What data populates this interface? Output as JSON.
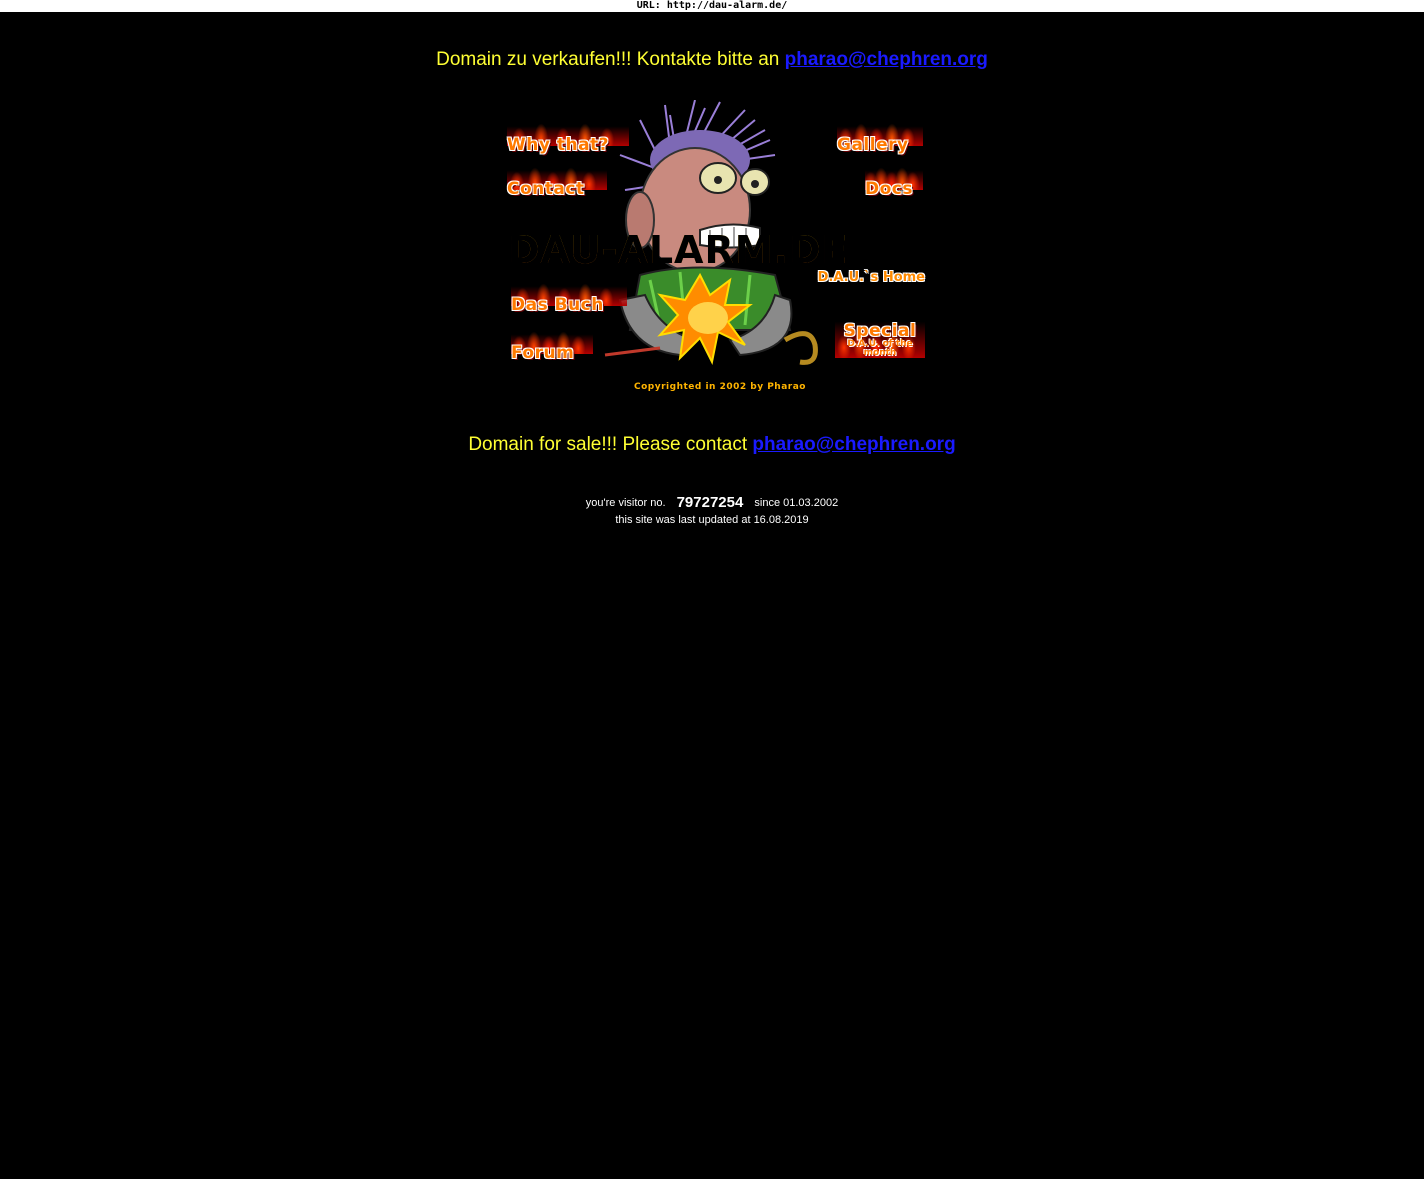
{
  "urlbar": {
    "text": "URL: http://dau-alarm.de/"
  },
  "sale_de": {
    "text": "Domain zu verkaufen!!! Kontakte bitte an ",
    "email": "pharao@chephren.org"
  },
  "sale_en": {
    "text": "Domain for sale!!! Please contact ",
    "email": "pharao@chephren.org"
  },
  "nav": {
    "why": "Why that?",
    "contact": "Contact",
    "gallery": "Gallery",
    "docs": "Docs",
    "buch": "Das Buch",
    "forum": "Forum",
    "special": "Special",
    "special_sub_1": "D.A.U. of the",
    "special_sub_2": "month"
  },
  "logo": {
    "title": "DAU-ALARM.DE",
    "tagline": "D.A.U.`s Home",
    "copyright": "Copyrighted in 2002 by Pharao"
  },
  "counter": {
    "prefix": "you're visitor no.",
    "number": "79727254",
    "suffix": "since 01.03.2002"
  },
  "updated": {
    "text": "this site was last updated at 16.08.2019"
  },
  "colors": {
    "background": "#000000",
    "sale_text": "#ffff33",
    "link": "#1a1aff",
    "logo": "#ff9500"
  },
  "icons": [
    "flame-graphic",
    "dau-cartoon-figure"
  ]
}
